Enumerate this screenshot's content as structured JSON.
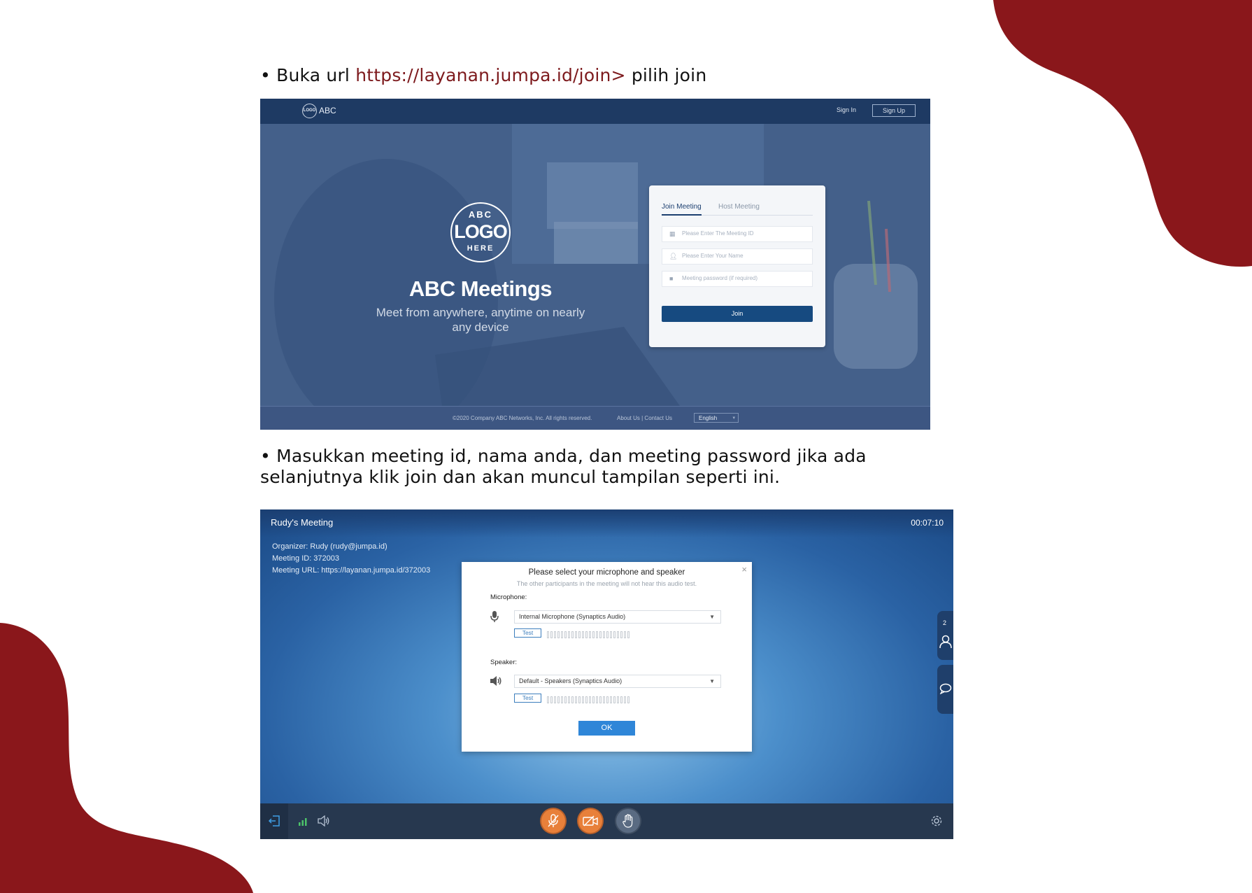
{
  "caption1": {
    "bullet": "• Buka url ",
    "link": "https://layanan.jumpa.id/join",
    "rest": " > pilih join"
  },
  "caption2": {
    "line1": "• Masukkan meeting id, nama anda, dan meeting password jika ada",
    "line2": "selanjutnya klik join dan akan muncul tampilan seperti ini."
  },
  "shot1": {
    "brand_logo_text": "LOGO",
    "brand_name": "ABC",
    "signin": "Sign In",
    "signup": "Sign Up",
    "logo": {
      "top": "ABC",
      "middle": "LOGO",
      "bottom": "HERE"
    },
    "hero_title": "ABC Meetings",
    "hero_sub": "Meet from anywhere, anytime on nearly any device",
    "tabs": {
      "active": "Join Meeting",
      "inactive": "Host Meeting"
    },
    "fields": {
      "meeting_id": "Please Enter The Meeting ID",
      "name": "Please Enter Your Name",
      "password": "Meeting password (if required)"
    },
    "join_label": "Join",
    "footer": {
      "copyright": "©2020 Company ABC Networks, Inc. All rights reserved.",
      "links": "About Us | Contact Us",
      "language": "English"
    }
  },
  "shot2": {
    "meeting_title": "Rudy's Meeting",
    "timer": "00:07:10",
    "organizer": "Organizer: Rudy (rudy@jumpa.id)",
    "meeting_id": "Meeting ID: 372003",
    "meeting_url": "Meeting URL: https://layanan.jumpa.id/372003",
    "dialog": {
      "title": "Please select your microphone and speaker",
      "subtitle": "The other participants in the meeting will not hear this audio test.",
      "mic_label": "Microphone:",
      "mic_device": "Internal Microphone (Synaptics Audio)",
      "speaker_label": "Speaker:",
      "speaker_device": "Default - Speakers (Synaptics Audio)",
      "test_label": "Test",
      "ok_label": "OK",
      "close": "×"
    },
    "participants_count": "2"
  },
  "colors": {
    "accent_red": "#8a171b",
    "link": "#7d1a1d",
    "orange": "#e8803a",
    "navy": "#1e3a63"
  }
}
